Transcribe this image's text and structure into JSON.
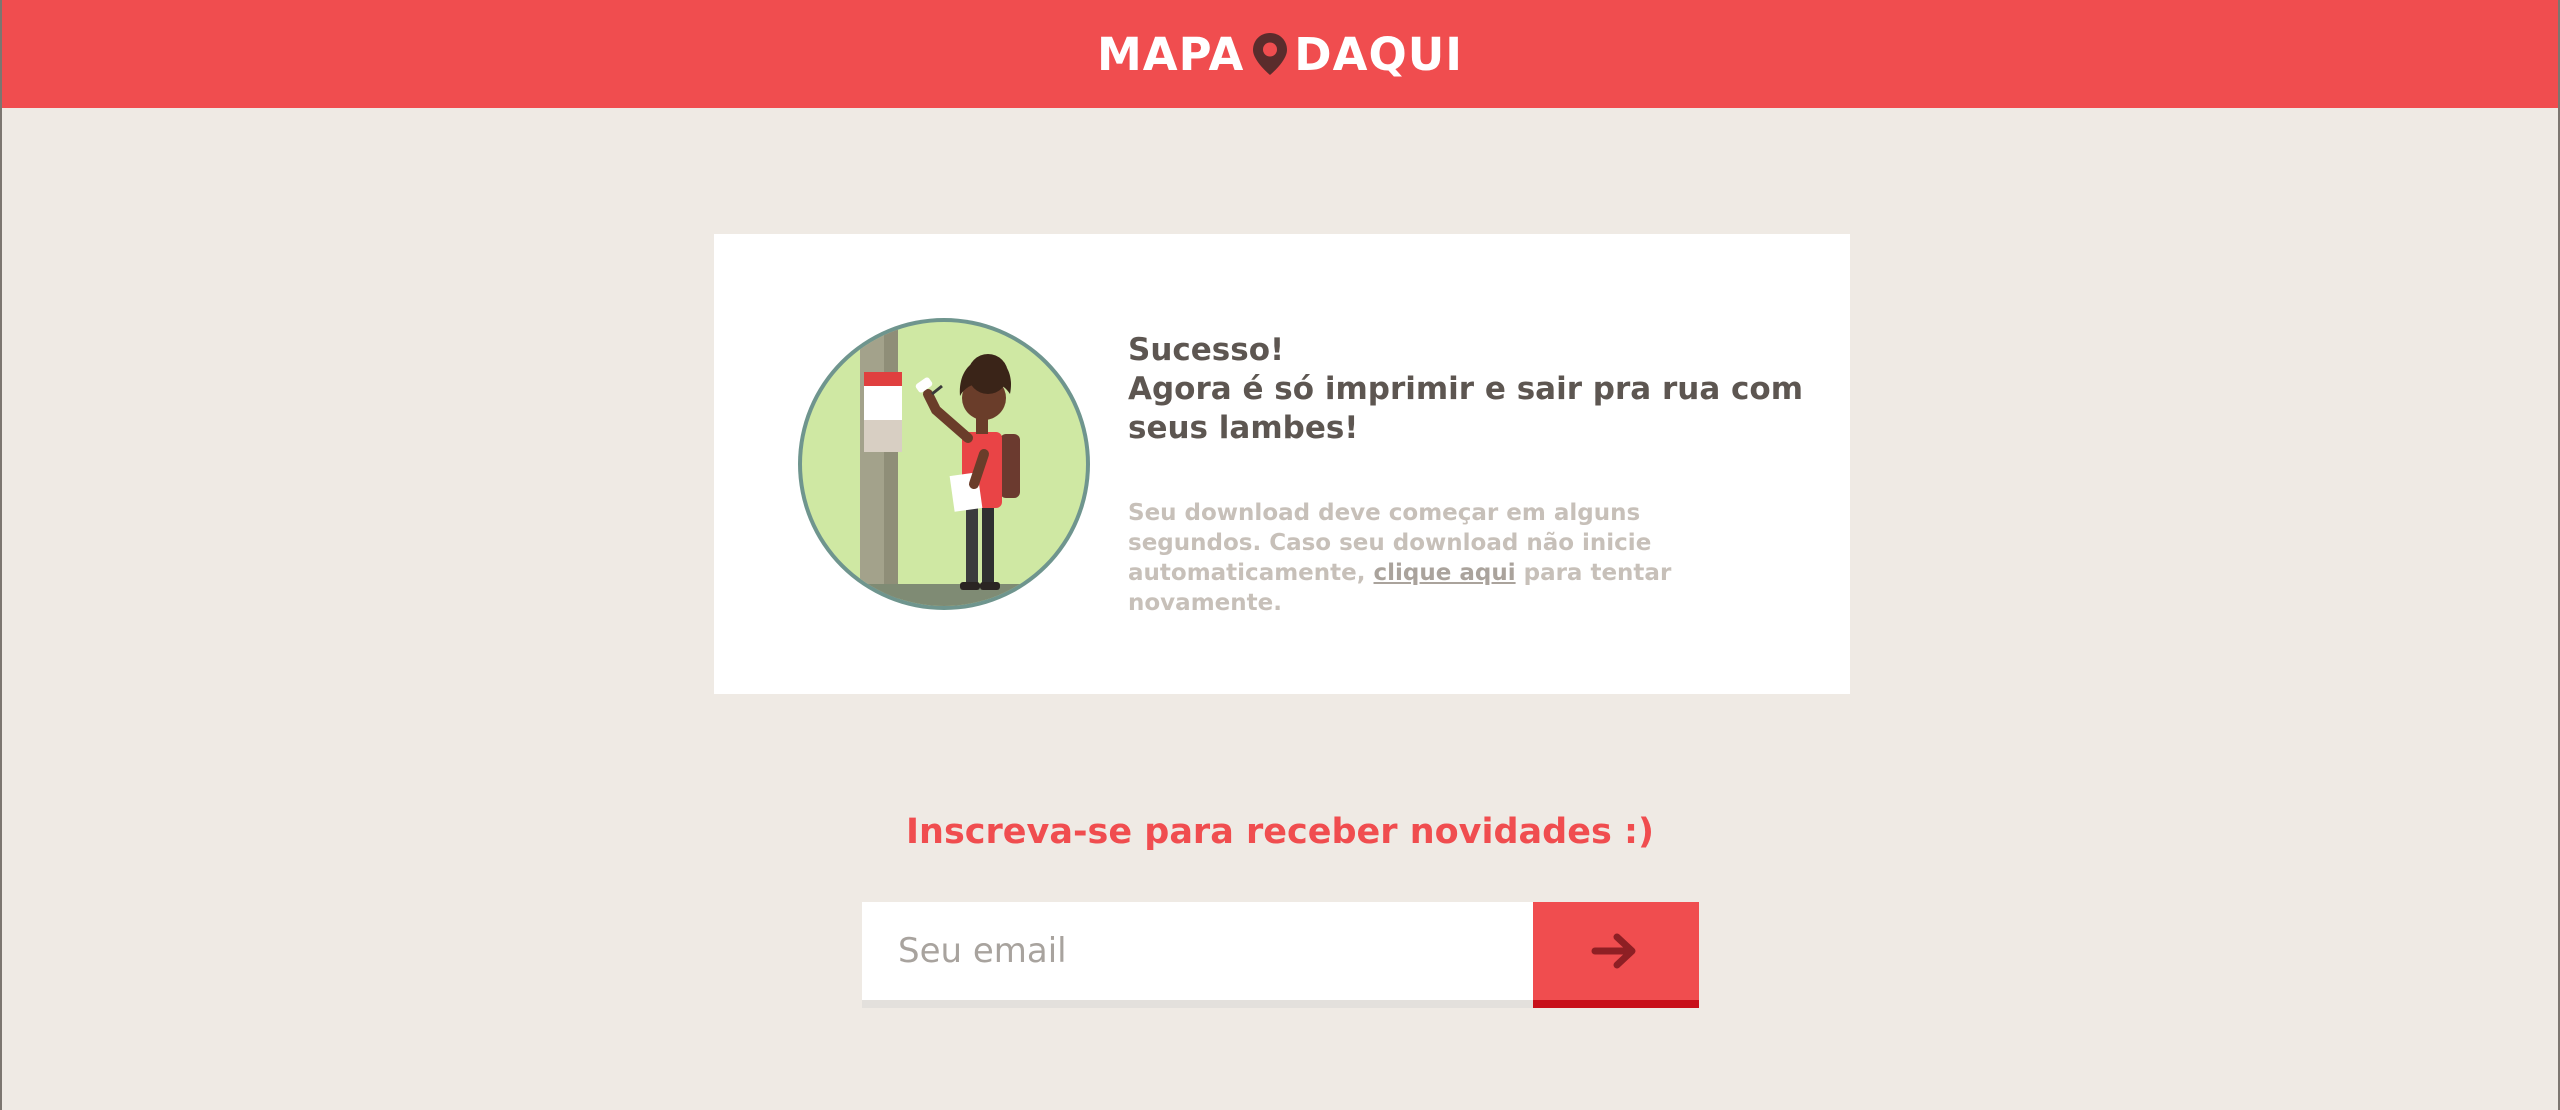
{
  "header": {
    "logo_left": "MAPA",
    "logo_right": "DAQUI",
    "logo_icon": "map-pin-icon",
    "background_color": "#f04d4f"
  },
  "success": {
    "title_line1": "Sucesso!",
    "title_line2": "Agora é só imprimir e sair pra rua com seus lambes!",
    "message_before_link": "Seu download deve começar em alguns segundos. Caso seu download não inicie automaticamente, ",
    "link_text": "clique aqui",
    "message_after_link": " para tentar novamente.",
    "illustration": "person-pasting-poster-illustration"
  },
  "newsletter": {
    "heading": "Inscreva-se para receber novidades :)",
    "email_placeholder": "Seu email",
    "email_value": "",
    "submit_icon": "arrow-right-icon",
    "accent_color": "#f04d4f"
  }
}
